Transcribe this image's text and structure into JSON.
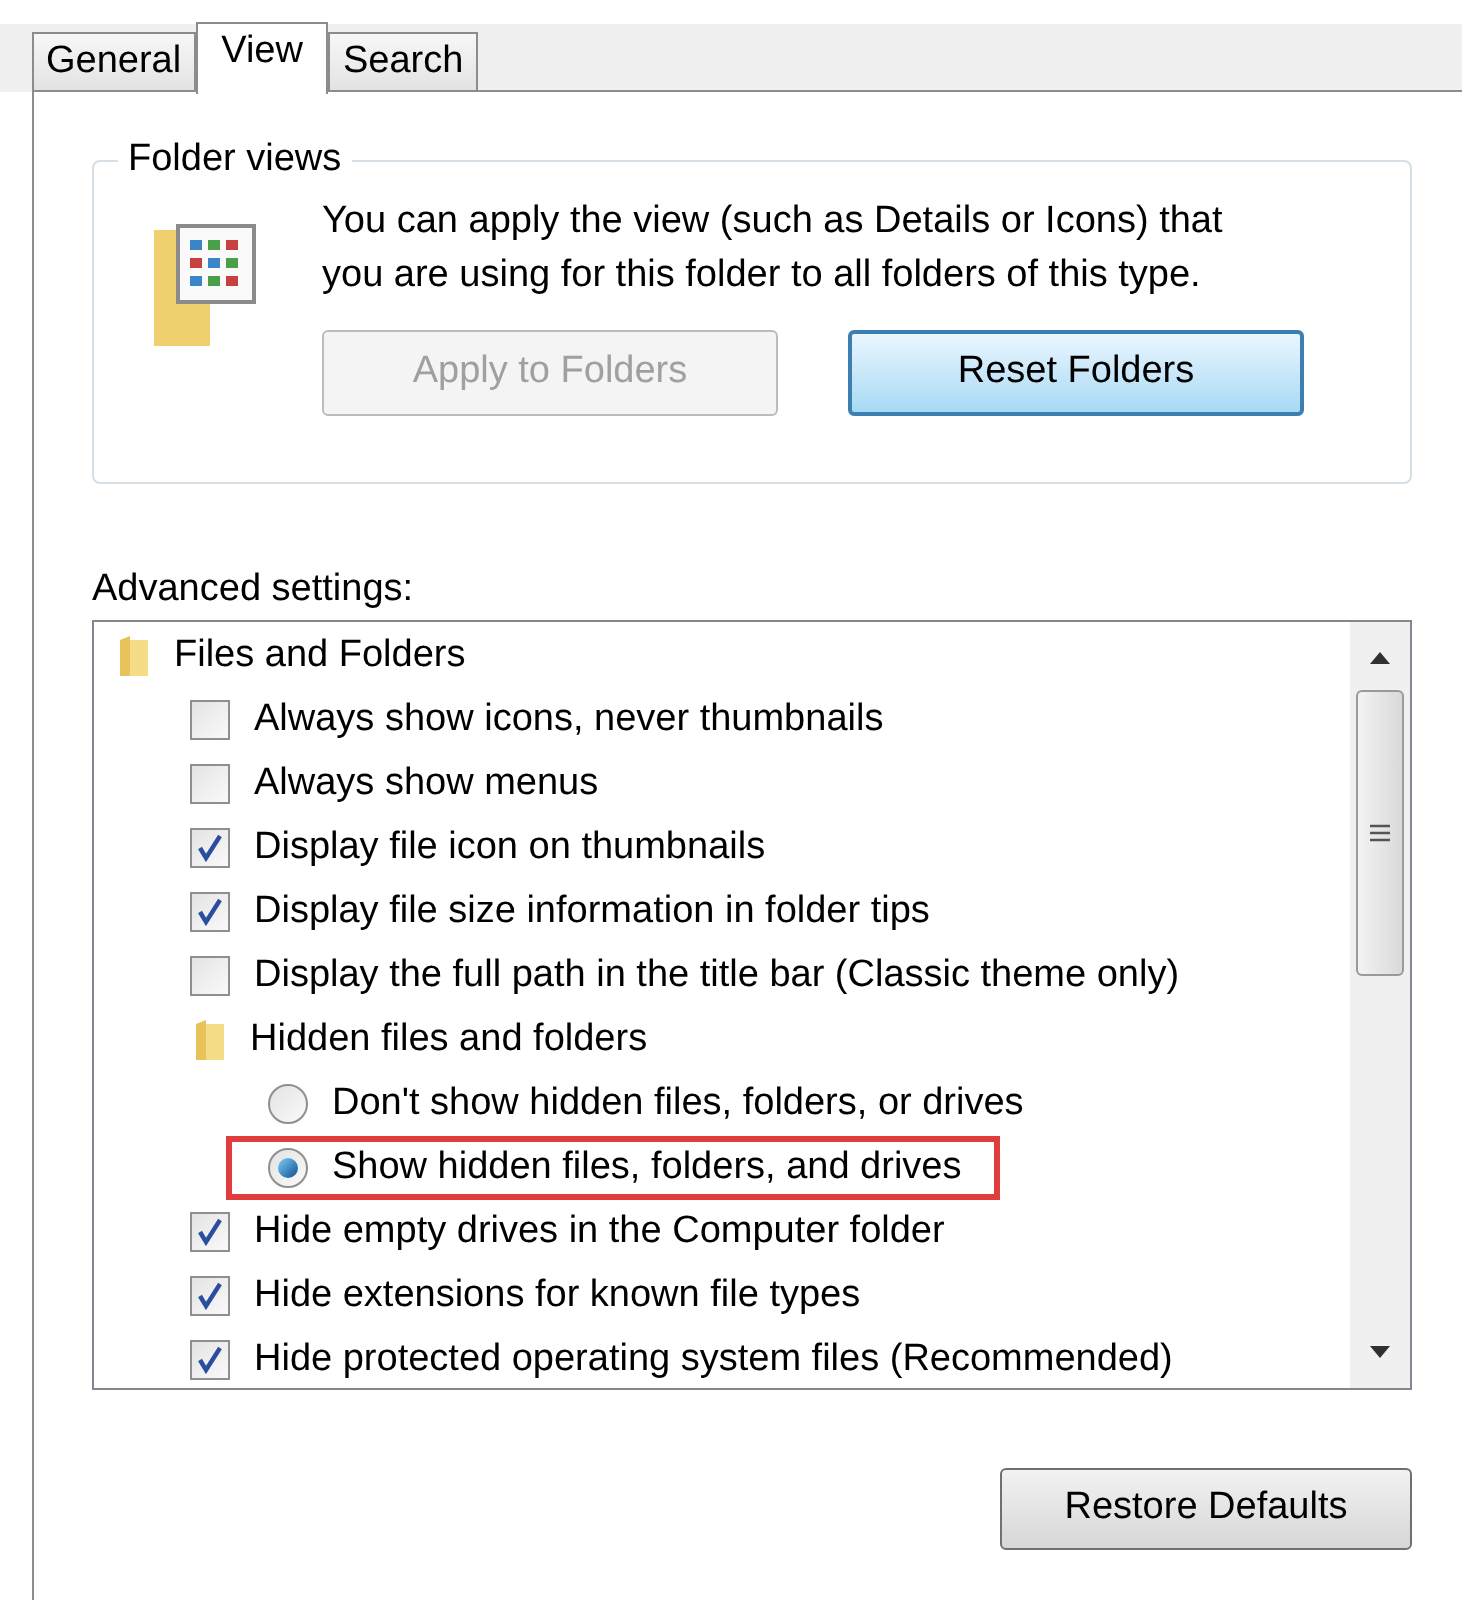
{
  "tabs": [
    {
      "label": "General",
      "selected": false
    },
    {
      "label": "View",
      "selected": true
    },
    {
      "label": "Search",
      "selected": false
    }
  ],
  "folder_views": {
    "title": "Folder views",
    "description": "You can apply the view (such as Details or Icons) that you are using for this folder to all folders of this type.",
    "buttons": [
      {
        "label": "Apply to Folders",
        "disabled": true,
        "focused": false
      },
      {
        "label": "Reset Folders",
        "disabled": false,
        "focused": true
      }
    ]
  },
  "advanced_settings": {
    "label": "Advanced settings:",
    "tree": [
      {
        "kind": "folder",
        "label": "Files and Folders",
        "children": [
          {
            "kind": "checkbox",
            "label": "Always show icons, never thumbnails",
            "checked": false
          },
          {
            "kind": "checkbox",
            "label": "Always show menus",
            "checked": false
          },
          {
            "kind": "checkbox",
            "label": "Display file icon on thumbnails",
            "checked": true
          },
          {
            "kind": "checkbox",
            "label": "Display file size information in folder tips",
            "checked": true
          },
          {
            "kind": "checkbox",
            "label": "Display the full path in the title bar (Classic theme only)",
            "checked": false
          },
          {
            "kind": "folder",
            "label": "Hidden files and folders",
            "children": [
              {
                "kind": "radio",
                "label": "Don't show hidden files, folders, or drives",
                "selected": false,
                "highlighted": false
              },
              {
                "kind": "radio",
                "label": "Show hidden files, folders, and drives",
                "selected": true,
                "highlighted": true
              }
            ]
          },
          {
            "kind": "checkbox",
            "label": "Hide empty drives in the Computer folder",
            "checked": true
          },
          {
            "kind": "checkbox",
            "label": "Hide extensions for known file types",
            "checked": true
          },
          {
            "kind": "checkbox",
            "label": "Hide protected operating system files (Recommended)",
            "checked": true
          }
        ]
      }
    ]
  },
  "restore_button": {
    "label": "Restore Defaults"
  }
}
